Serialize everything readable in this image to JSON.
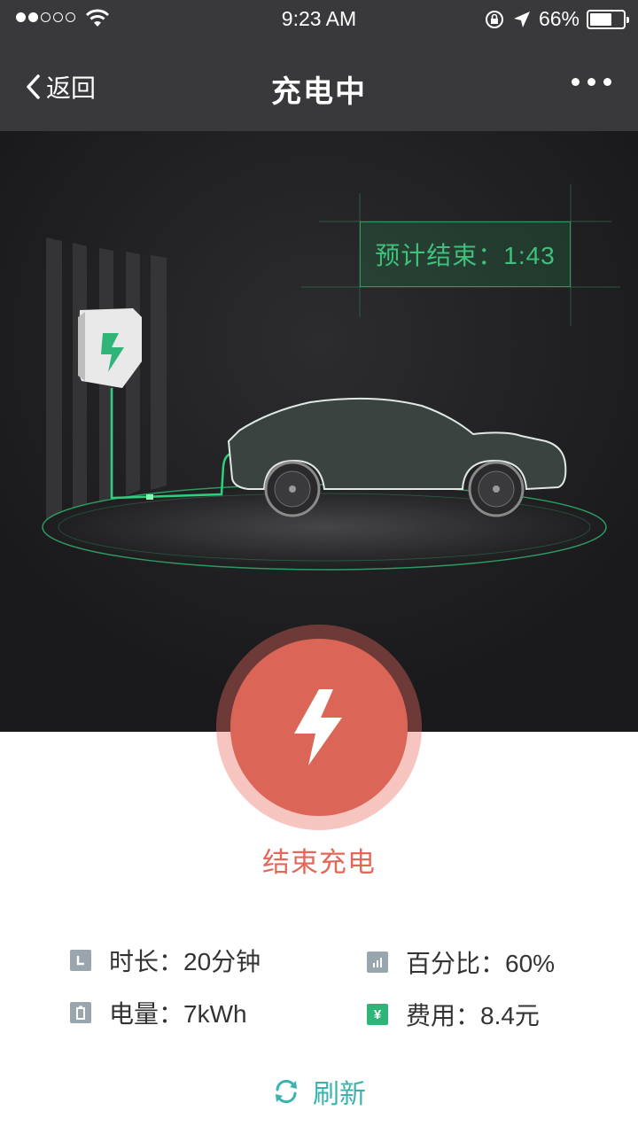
{
  "status_bar": {
    "time": "9:23 AM",
    "battery_pct": "66%",
    "battery_level": 0.66
  },
  "nav": {
    "back_label": "返回",
    "title": "充电中"
  },
  "scene": {
    "eta_label": "预计结束：1:43"
  },
  "stop": {
    "label": "结束充电"
  },
  "stats": {
    "duration": "时长：20分钟",
    "percent": "百分比：60%",
    "energy": "电量：7kWh",
    "cost": "费用：8.4元"
  },
  "refresh_label": "刷新",
  "colors": {
    "accent_green": "#3fc07c",
    "stop_red": "#db6657",
    "refresh_teal": "#3ab3ae",
    "nav_bg": "#39393c"
  },
  "icons": [
    "wifi-icon",
    "lock-rotation-icon",
    "location-arrow-icon",
    "battery-icon",
    "back-chevron-icon",
    "more-icon",
    "charger-icon",
    "lightning-icon",
    "clock-icon",
    "bar-chart-icon",
    "battery-small-icon",
    "yuan-icon",
    "refresh-icon"
  ]
}
